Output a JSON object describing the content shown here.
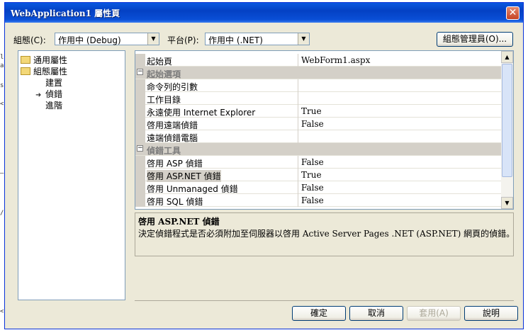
{
  "window": {
    "title": "WebApplication1 屬性頁"
  },
  "toolbar": {
    "config_label": "組態(C):",
    "config_value": "作用中 (Debug)",
    "platform_label": "平台(P):",
    "platform_value": "作用中 (.NET)",
    "config_manager_label": "組態管理員(O)..."
  },
  "tree": [
    {
      "label": "通用屬性"
    },
    {
      "label": "組態屬性"
    },
    {
      "label": "建置"
    },
    {
      "label": "偵錯"
    },
    {
      "label": "進階"
    }
  ],
  "grid": {
    "rows": [
      {
        "name": "起始頁",
        "value": "WebForm1.aspx"
      },
      {
        "name": "起始選項"
      },
      {
        "name": "命令列的引數",
        "value": ""
      },
      {
        "name": "工作目錄",
        "value": ""
      },
      {
        "name": "永遠使用 Internet Explorer",
        "value": "True"
      },
      {
        "name": "啓用遠端偵錯",
        "value": "False"
      },
      {
        "name": "遠端偵錯電腦",
        "value": ""
      },
      {
        "name": "偵錯工具"
      },
      {
        "name": "啓用 ASP 偵錯",
        "value": "False"
      },
      {
        "name": "啓用 ASP.NET 偵錯",
        "value": "True"
      },
      {
        "name": "啓用 Unmanaged 偵錯",
        "value": "False"
      },
      {
        "name": "啓用 SQL 偵錯",
        "value": "False"
      }
    ]
  },
  "description": {
    "title": "啓用 ASP.NET 偵錯",
    "text": "決定偵錯程式是否必須附加至伺服器以啓用 Active Server Pages .NET (ASP.NET) 網頁的偵錯。"
  },
  "buttons": {
    "ok": "確定",
    "cancel": "取消",
    "apply": "套用(A)",
    "help": "說明"
  },
  "background_code": [
    "l",
    "af",
    "sy",
    "<",
    "—",
    "/",
    "<"
  ]
}
